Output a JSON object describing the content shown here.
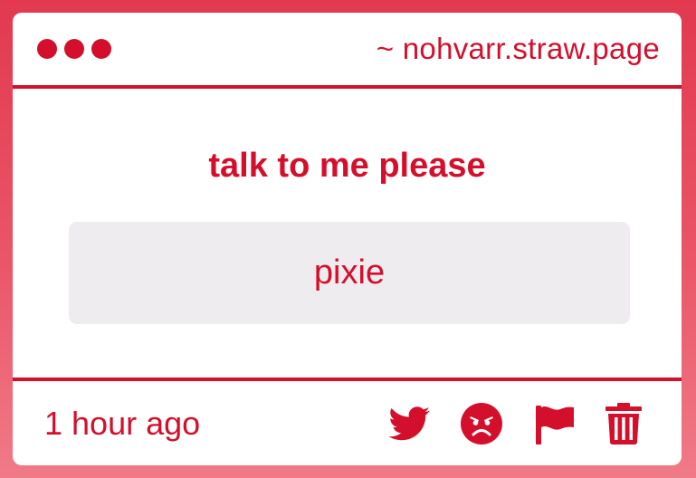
{
  "window": {
    "site": "~ nohvarr.straw.page"
  },
  "question": "talk to me please",
  "answer": "pixie",
  "footer": {
    "timestamp": "1 hour ago",
    "actions": [
      "twitter-icon",
      "angry-face-icon",
      "flag-icon",
      "trash-icon"
    ]
  },
  "colors": {
    "accent": "#d40f2c",
    "answer_bg": "#eeecee",
    "background": "#e2394f"
  }
}
